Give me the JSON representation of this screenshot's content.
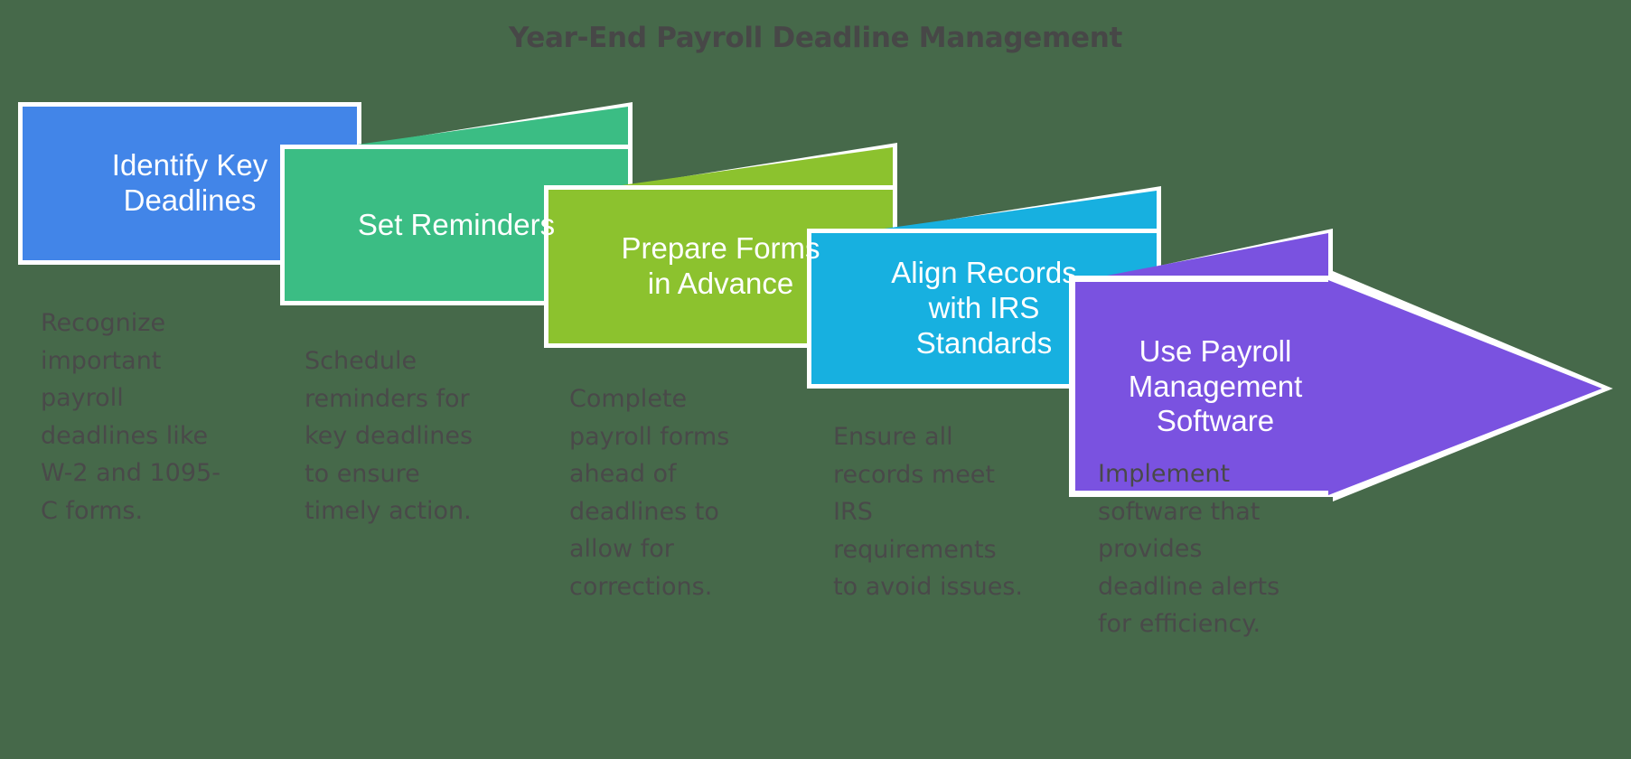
{
  "title": "Year-End Payroll Deadline Management",
  "background_color": "#46694a",
  "title_color": "#474747",
  "description_color": "#494949",
  "outline_color": "#ffffff",
  "steps": [
    {
      "label": "Identify Key\nDeadlines",
      "description": "Recognize\nimportant\npayroll\ndeadlines like\nW-2 and 1095-\nC forms.",
      "color": "#4285e8"
    },
    {
      "label": "Set Reminders",
      "description": "Schedule\nreminders for\nkey deadlines\nto ensure\ntimely action.",
      "color": "#3bbd84"
    },
    {
      "label": "Prepare Forms\nin Advance",
      "description": "Complete\npayroll forms\nahead of\ndeadlines to\nallow for\ncorrections.",
      "color": "#8cc22e"
    },
    {
      "label": "Align Records\nwith IRS\nStandards",
      "description": "Ensure all\nrecords meet\nIRS\nrequirements\nto avoid issues.",
      "color": "#17b0e0"
    },
    {
      "label": "Use Payroll\nManagement\nSoftware",
      "description": "Implement\nsoftware that\nprovides\ndeadline alerts\nfor efficiency.",
      "color": "#7a52e0"
    }
  ]
}
